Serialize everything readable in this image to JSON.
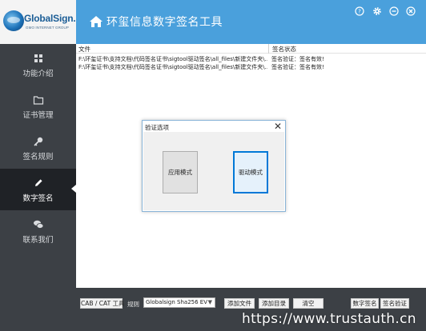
{
  "brand": {
    "logo_text": "GlobalSign.",
    "logo_sub": "GMO INTERNET GROUP",
    "accent_color": "#4aa0dc"
  },
  "header": {
    "title": "环玺信息数字签名工具",
    "icons": [
      "help-icon",
      "settings-icon",
      "minimize-icon",
      "close-icon"
    ]
  },
  "sidebar": {
    "items": [
      {
        "label": "功能介绍",
        "icon": "grid-icon"
      },
      {
        "label": "证书管理",
        "icon": "folder-icon"
      },
      {
        "label": "签名规则",
        "icon": "key-icon"
      },
      {
        "label": "数字签名",
        "icon": "pencil-icon",
        "active": true
      },
      {
        "label": "联系我们",
        "icon": "chat-icon"
      }
    ]
  },
  "file_list": {
    "columns": [
      "文件",
      "签名状态"
    ],
    "rows": [
      {
        "file": "F:\\环玺证书\\支持文档\\代码签名证书\\sigtool驱动签名\\all_files\\新建文件夹\\...",
        "status": "签名验证：签名有效!"
      },
      {
        "file": "F:\\环玺证书\\支持文档\\代码签名证书\\sigtool驱动签名\\all_files\\新建文件夹\\...",
        "status": "签名验证：签名有效!"
      }
    ]
  },
  "toolbar": {
    "cab_cat_label": "CAB / CAT 工具",
    "rule_label": "规则",
    "rule_value": "Globalsign Sha256 EV",
    "add_file_label": "添加文件",
    "add_dir_label": "添加目录",
    "clear_label": "清空",
    "sign_label": "数字签名",
    "verify_label": "签名验证"
  },
  "dialog": {
    "title": "验证选项",
    "close_symbol": "✕",
    "app_mode_label": "应用模式",
    "driver_mode_label": "驱动模式"
  },
  "watermark": "https://www.trustauth.cn"
}
